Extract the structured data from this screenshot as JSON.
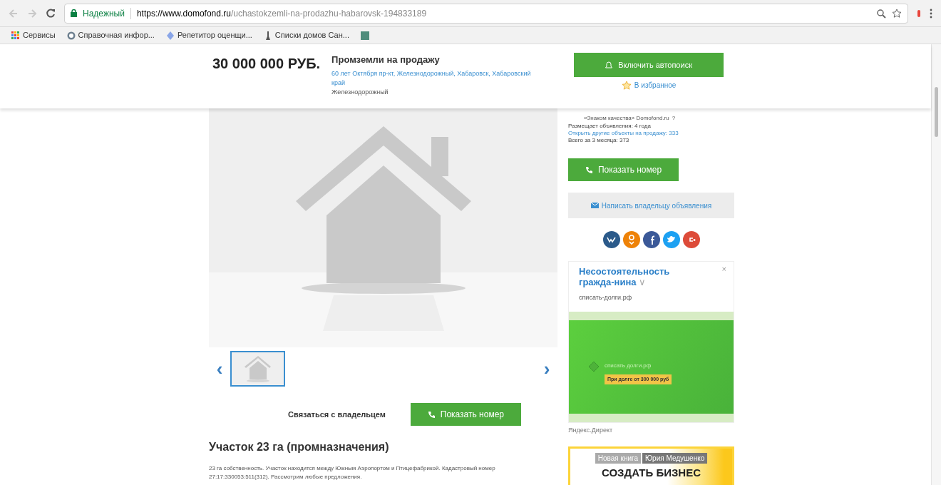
{
  "browser": {
    "security": "Надежный",
    "url_host": "https://www.domofond.ru",
    "url_path": "/uchastokzemli-na-prodazhu-habarovsk-194833189",
    "bookmarks": [
      {
        "label": "Сервисы",
        "kind": "apps"
      },
      {
        "label": "Справочная инфор...",
        "kind": "globe"
      },
      {
        "label": "Репетитор оценщи...",
        "kind": "diamond"
      },
      {
        "label": "Списки домов Сан...",
        "kind": "pin"
      },
      {
        "kind": "tile"
      }
    ]
  },
  "header": {
    "price": "30 000 000 РУБ.",
    "title": "Промземли на продажу",
    "address": "60 лет Октября пр-кт, Железнодорожный, Хабаровск, Хабаровский край",
    "district": "Железнодорожный",
    "autosearch_button": "Включить автопоиск",
    "favorite_link": "В избранное"
  },
  "gallery": {
    "prev": "‹",
    "next": "›",
    "thumbnails": [
      {
        "selected": true
      }
    ]
  },
  "contact": {
    "label": "Связаться с владельцем",
    "phone_button": "Показать номер"
  },
  "listing": {
    "title": "Участок 23 га (промназначения)",
    "description": "23 га собственность. Участок находится между Южным Аэропортом и Птицефабрикой. Кадастровый номер 27:17:330053:511(312). Рассмотрим любые предложения."
  },
  "seller": {
    "badge": "«Знаком качества» Domofond.ru",
    "help": "?",
    "lines": [
      {
        "text": "Размещает объявления: 4 года",
        "kind": "text"
      },
      {
        "text": "Открыть другие объекты на продажу: 333",
        "kind": "link"
      },
      {
        "text": "Всего за 3 месяца: 373",
        "kind": "text"
      }
    ],
    "phone_button": "Показать номер",
    "message_button": "Написать владельцу объявления",
    "share": [
      {
        "kind": "vk",
        "color": "#2b5a8a"
      },
      {
        "kind": "ok",
        "color": "#ee8208"
      },
      {
        "kind": "facebook",
        "color": "#3b5998"
      },
      {
        "kind": "twitter",
        "color": "#1da1f2"
      },
      {
        "kind": "google",
        "color": "#dd4b39"
      }
    ]
  },
  "ads": [
    {
      "title": "Несостоятельность гражда-нина",
      "chevron": "∨",
      "close": "×",
      "domain": "списать-долги.рф",
      "banner_text": "списать долги.рф",
      "banner_badge": "При долге от 300 000 руб",
      "caption": "Яндекс.Директ"
    },
    {
      "tag_1": "Новая книга",
      "tag_2": "Юрия Медушенко",
      "headline": "СОЗДАТЬ БИЗНЕС"
    }
  ]
}
